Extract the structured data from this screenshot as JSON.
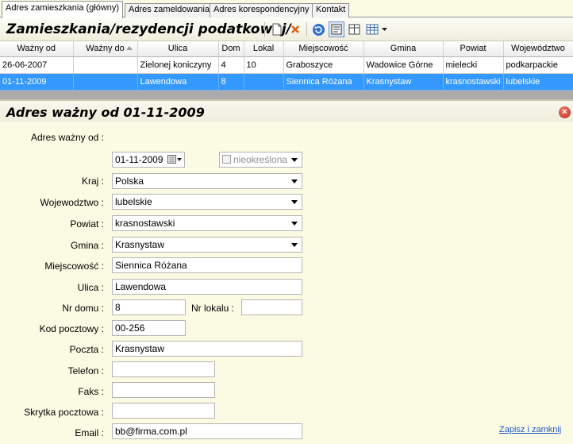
{
  "tabs": [
    {
      "label": "Adres  zamieszkania (główny)",
      "active": true
    },
    {
      "label": "Adres zameldowania",
      "active": false
    },
    {
      "label": "Adres korespondencyjny",
      "active": false
    },
    {
      "label": "Kontakt",
      "active": false
    }
  ],
  "header": {
    "title": "Zamieszkania/rezydencji podatkowej/"
  },
  "toolbar": {
    "icons": [
      "new-document-icon",
      "delete-icon",
      "refresh-icon",
      "form-view-icon",
      "split-view-icon",
      "grid-view-icon",
      "chevron-down-icon"
    ]
  },
  "grid": {
    "columns": [
      "Ważny od",
      "Ważny do",
      "Ulica",
      "Dom",
      "Lokal",
      "Miejscowość",
      "Gmina",
      "Powiat",
      "Województwo"
    ],
    "sorted_column": "Ważny do",
    "rows": [
      [
        "26-06-2007",
        "",
        "Zielonej koniczyny",
        "4",
        "10",
        "Graboszyce",
        "Wadowice Górne",
        "mielecki",
        "podkarpackie"
      ],
      [
        "01-11-2009",
        "",
        "Lawendowa",
        "8",
        "",
        "Siennica Różana",
        "Krasnystaw",
        "krasnostawski",
        "lubelskie"
      ]
    ],
    "selected_row": 1
  },
  "form": {
    "title": "Adres ważny od 01-11-2009",
    "labels": {
      "valid_from": "Adres ważny od :",
      "country": "Kraj :",
      "voivodeship": "Wojewodztwo :",
      "county": "Powiat :",
      "commune": "Gmina :",
      "town": "Miejscowość :",
      "street": "Ulica :",
      "house": "Nr domu :",
      "flat": "Nr lokalu :",
      "postal": "Kod pocztowy :",
      "post": "Poczta :",
      "phone": "Telefon :",
      "fax": "Faks :",
      "pobox": "Skrytka pocztowa :",
      "email": "Email  :"
    },
    "values": {
      "valid_from": "01-11-2009",
      "indefinite": "nieokreślona",
      "country": "Polska",
      "voivodeship": "lubelskie",
      "county": "krasnostawski",
      "commune": "Krasnystaw",
      "town": "Siennica Różana",
      "street": "Lawendowa",
      "house": "8",
      "flat": "",
      "postal": "00-256",
      "post": "Krasnystaw",
      "phone": "",
      "fax": "",
      "pobox": "",
      "email": "bb@firma.com.pl"
    },
    "save_close": "Zapisz i zamknij"
  },
  "colors": {
    "selection": "#3399ff",
    "background": "#fbfae3",
    "link": "#1b56c9"
  }
}
